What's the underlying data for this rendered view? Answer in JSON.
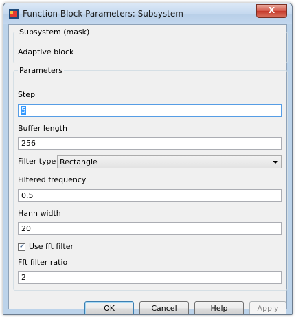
{
  "window": {
    "title": "Function Block Parameters: Subsystem",
    "close_label": "X"
  },
  "mask_group": {
    "legend": "Subsystem (mask)",
    "description": "Adaptive block"
  },
  "params_group": {
    "legend": "Parameters",
    "step": {
      "label": "Step",
      "value": "5"
    },
    "buffer_length": {
      "label": "Buffer length",
      "value": "256"
    },
    "filter_type": {
      "label": "Filter type",
      "value": "Rectangle"
    },
    "filtered_frequency": {
      "label": "Filtered frequency",
      "value": "0.5"
    },
    "hann_width": {
      "label": "Hann width",
      "value": "20"
    },
    "use_fft_filter": {
      "label": "Use fft filter",
      "checked": true
    },
    "fft_filter_ratio": {
      "label": "Fft filter ratio",
      "value": "2"
    }
  },
  "buttons": {
    "ok": "OK",
    "cancel": "Cancel",
    "help": "Help",
    "apply": "Apply"
  },
  "icons": {
    "window_icon": "simulink-block-icon",
    "close": "close-icon"
  },
  "colors": {
    "title_bar": "#c5d9ef",
    "close_button": "#c5392b",
    "client_bg": "#f0f0f0",
    "focus_border": "#569de5"
  }
}
